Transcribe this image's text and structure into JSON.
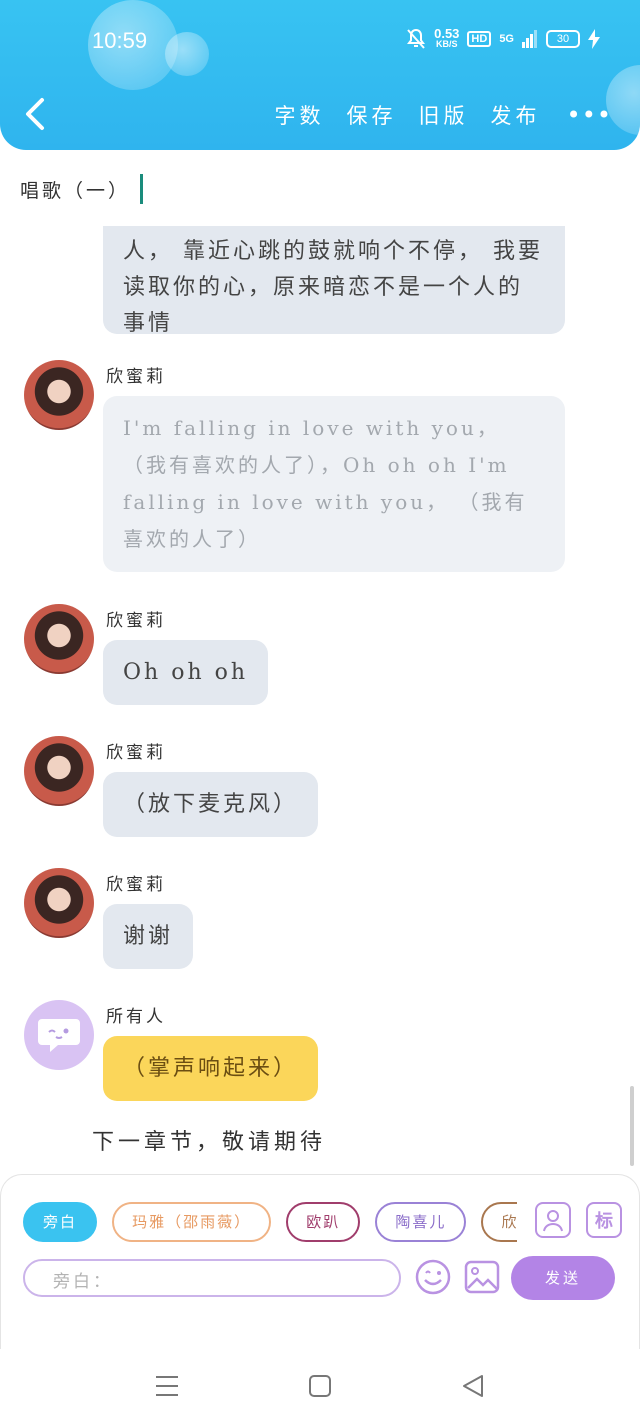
{
  "status_bar": {
    "time": "10:59",
    "net_speed": "0.53",
    "net_speed_unit": "KB/S",
    "hd": "HD",
    "network": "5G",
    "battery": "30"
  },
  "header": {
    "actions": [
      "字数",
      "保存",
      "旧版",
      "发布"
    ],
    "more_label": "•••"
  },
  "chapter_title": "唱歌（一）",
  "messages": [
    {
      "sender": "",
      "text": "人，    靠近心跳的鼓就响个不停，  我要读取你的心，原来暗恋不是一个人的事情",
      "style": "normal"
    },
    {
      "sender": "欣蜜莉",
      "text": "I'm falling in love with you，  （我有喜欢的人了），Oh oh oh  I'm falling in love with you，  （我有喜欢的人了）",
      "style": "light"
    },
    {
      "sender": "欣蜜莉",
      "text": "Oh oh oh",
      "style": "normal"
    },
    {
      "sender": "欣蜜莉",
      "text": "（放下麦克风）",
      "style": "normal"
    },
    {
      "sender": "欣蜜莉",
      "text": "谢谢",
      "style": "normal"
    },
    {
      "sender": "所有人",
      "text": "（掌声响起来）",
      "style": "yellow"
    }
  ],
  "next_chapter": "下一章节，敬请期待",
  "composer": {
    "roles": [
      {
        "label": "旁白",
        "active": true
      },
      {
        "label": "玛雅（邵雨薇）",
        "active": false
      },
      {
        "label": "欧趴",
        "active": false
      },
      {
        "label": "陶喜儿",
        "active": false
      },
      {
        "label": "欣",
        "active": false
      }
    ],
    "tag_label": "标",
    "input_placeholder": "旁白：",
    "send_label": "发送"
  },
  "colors": {
    "header": "#38c3f2",
    "accent_purple": "#b384e6",
    "bubble_gray": "#e3e8ef",
    "bubble_yellow": "#fbd65a",
    "active_chip": "#3ac3f0"
  }
}
